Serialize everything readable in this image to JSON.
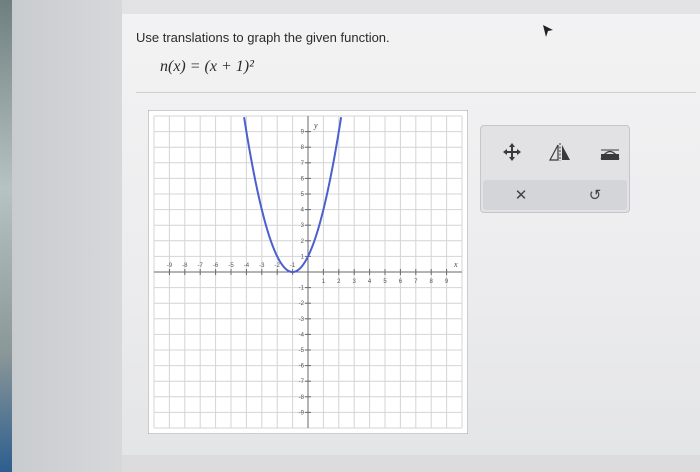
{
  "question": {
    "prompt": "Use translations to graph the given function.",
    "function_label": "n(x) = (x + 1)²"
  },
  "graph": {
    "x_axis_label": "x",
    "y_axis_label": "y",
    "x_ticks": [
      "-9",
      "-8",
      "-7",
      "-6",
      "-5",
      "-4",
      "-3",
      "-2",
      "-1",
      "1",
      "2",
      "3",
      "4",
      "5",
      "6",
      "7",
      "8",
      "9"
    ],
    "y_ticks": [
      "9",
      "8",
      "7",
      "6",
      "5",
      "4",
      "3",
      "2",
      "1",
      "-1",
      "-2",
      "-3",
      "-4",
      "-5",
      "-6",
      "-7",
      "-8",
      "-9"
    ],
    "curve_color": "#4a5fd0",
    "curve": {
      "vertex": [
        -1,
        0
      ],
      "a": 1
    },
    "xlim": [
      -10,
      10
    ],
    "ylim": [
      -10,
      10
    ]
  },
  "toolbox": {
    "tools": [
      "move-icon",
      "reflect-icon",
      "stretch-icon"
    ],
    "actions": {
      "clear_glyph": "✕",
      "undo_glyph": "↺"
    }
  }
}
